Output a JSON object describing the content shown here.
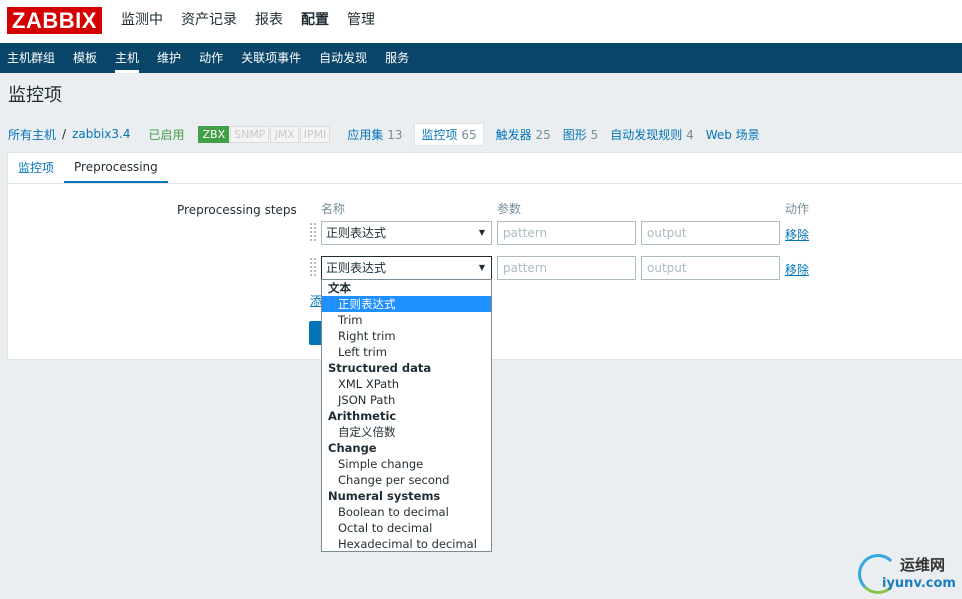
{
  "logo": "ZABBIX",
  "top_menu": [
    "监测中",
    "资产记录",
    "报表",
    "配置",
    "管理"
  ],
  "top_menu_active": "配置",
  "sub_menu": [
    "主机群组",
    "模板",
    "主机",
    "维护",
    "动作",
    "关联项事件",
    "自动发现",
    "服务"
  ],
  "sub_menu_active": "主机",
  "page_title": "监控项",
  "host_nav": {
    "all_hosts": "所有主机",
    "separator": "/",
    "host": "zabbix3.4",
    "status": "已启用",
    "badges": [
      {
        "label": "ZBX",
        "on": true
      },
      {
        "label": "SNMP",
        "on": false
      },
      {
        "label": "JMX",
        "on": false
      },
      {
        "label": "IPMI",
        "on": false
      }
    ],
    "tabs": [
      {
        "label": "应用集",
        "count": "13"
      },
      {
        "label": "监控项",
        "count": "65"
      },
      {
        "label": "触发器",
        "count": "25"
      },
      {
        "label": "图形",
        "count": "5"
      },
      {
        "label": "自动发现规则",
        "count": "4"
      },
      {
        "label": "Web 场景",
        "count": ""
      }
    ]
  },
  "form_tabs": [
    "监控项",
    "Preprocessing"
  ],
  "form_tab_active": "Preprocessing",
  "preprocessing": {
    "label": "Preprocessing steps",
    "col_name": "名称",
    "col_params": "参数",
    "col_action": "动作",
    "rows": [
      {
        "type": "正则表达式",
        "param1_placeholder": "pattern",
        "param2_placeholder": "output",
        "remove": "移除"
      },
      {
        "type": "正则表达式",
        "param1_placeholder": "pattern",
        "param2_placeholder": "output",
        "remove": "移除"
      }
    ],
    "add_partial": "添"
  },
  "dropdown": {
    "groups": [
      {
        "label": "文本",
        "options": [
          "正则表达式",
          "Trim",
          "Right trim",
          "Left trim"
        ]
      },
      {
        "label": "Structured data",
        "options": [
          "XML XPath",
          "JSON Path"
        ]
      },
      {
        "label": "Arithmetic",
        "options": [
          "自定义倍数"
        ]
      },
      {
        "label": "Change",
        "options": [
          "Simple change",
          "Change per second"
        ]
      },
      {
        "label": "Numeral systems",
        "options": [
          "Boolean to decimal",
          "Octal to decimal",
          "Hexadecimal to decimal"
        ]
      }
    ],
    "selected": "正则表达式"
  },
  "watermark": {
    "line1": "运维网",
    "line2": "iyunv.com"
  },
  "colors": {
    "brand_red": "#d40000",
    "nav_blue": "#0a466a",
    "link_blue": "#0275b8",
    "enabled_green": "#429e47",
    "select_highlight": "#1e90ff"
  }
}
